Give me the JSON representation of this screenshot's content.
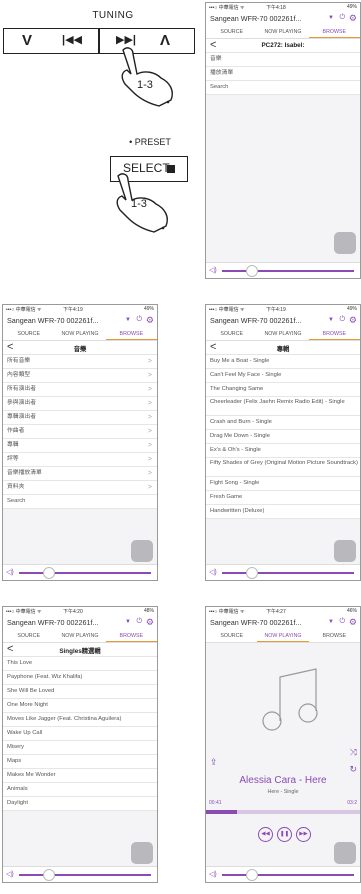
{
  "manual": {
    "tuning_label": "TUNING",
    "tuning_buttons": [
      "V",
      "|◀◀",
      "▶▶|",
      "Λ"
    ],
    "step_1": "1-3",
    "preset_label": "• PRESET",
    "select_label": "SELECT",
    "step_2": "1-3"
  },
  "common": {
    "device_name": "Sangean WFR-70 002261f...",
    "tabs": [
      "SOURCE",
      "NOW PLAYING",
      "BROWSE"
    ],
    "carrier": "•••○ 中華電信 ᯤ"
  },
  "screens": [
    {
      "time": "下午4:18",
      "battery": "49%",
      "active_tab": "BROWSE",
      "header": "PC272: Isabel:",
      "rows": [
        "音樂",
        "播放清單",
        "Search"
      ]
    },
    {
      "time": "下午4:19",
      "battery": "49%",
      "active_tab": "BROWSE",
      "header": "音樂",
      "rows": [
        "所有音樂",
        "內容類型",
        "所有演出者",
        "參與演出者",
        "專輯演出者",
        "作曲者",
        "專輯",
        "評等",
        "音樂播放清單",
        "資料夾",
        "Search"
      ]
    },
    {
      "time": "下午4:19",
      "battery": "49%",
      "active_tab": "BROWSE",
      "header": "專輯",
      "rows": [
        "Buy Me a Boat - Single",
        "Can't Feel My Face - Single",
        "The Changing Same",
        "Cheerleader (Felix Jaehn Remix Radio Edit) - Single",
        "Crash and Burn - Single",
        "Drag Me Down - Single",
        "Ex's & Oh's - Single",
        "Fifty Shades of Grey (Original Motion Picture Soundtrack)",
        "Fight Song - Single",
        "Fresh Game",
        "Handwritten (Deluxe)"
      ]
    },
    {
      "time": "下午4:20",
      "battery": "48%",
      "active_tab": "BROWSE",
      "header": "Singles精選輯",
      "rows": [
        "This Love",
        "Payphone (Feat. Wiz Khalifa)",
        "She Will Be Loved",
        "One More Night",
        "Moves Like Jagger (Feat. Christina Aguilera)",
        "Wake Up Call",
        "Misery",
        "Maps",
        "Makes Me Wonder",
        "Animals",
        "Daylight"
      ]
    },
    {
      "time": "下午4:27",
      "battery": "46%",
      "active_tab": "NOW PLAYING",
      "track_title": "Alessia Cara - Here",
      "track_sub": "Here - Single",
      "elapsed": "00:41",
      "duration": "03:2",
      "progress": 0.2
    }
  ],
  "colors": {
    "accent": "#8a4bb5",
    "tab_underline": "#e39a37"
  }
}
